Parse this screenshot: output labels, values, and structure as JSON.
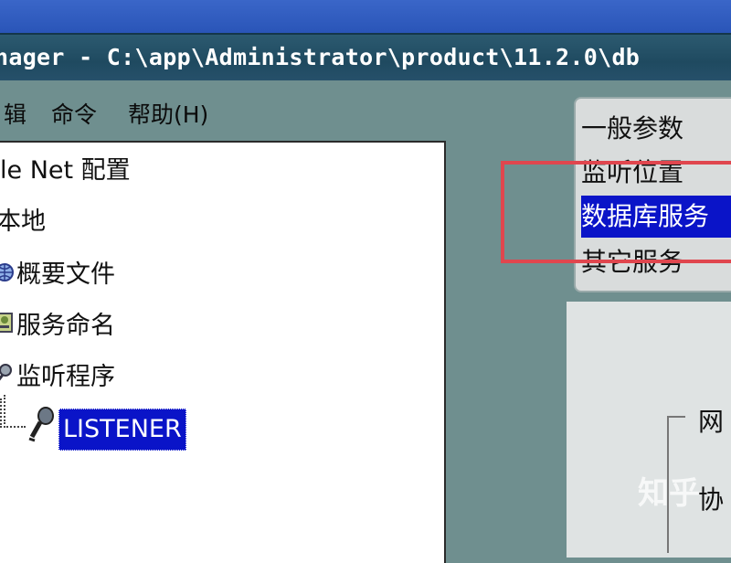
{
  "window": {
    "title": "nager - C:\\app\\Administrator\\product\\11.2.0\\db"
  },
  "menu": {
    "items": [
      {
        "label": "辑"
      },
      {
        "label": "命令"
      },
      {
        "label": "帮助(H)"
      }
    ]
  },
  "tree": {
    "root_label": "le Net 配置",
    "local_label": "本地",
    "profile_label": "概要文件",
    "service_naming_label": "服务命名",
    "listeners_label": "监听程序",
    "listener_label": "LISTENER"
  },
  "list_panel": {
    "items": [
      {
        "label": "一般参数",
        "selected": false
      },
      {
        "label": "监听位置",
        "selected": false
      },
      {
        "label": "数据库服务",
        "selected": true
      },
      {
        "label": "其它服务",
        "selected": false
      }
    ]
  },
  "right_panel": {
    "text1": "网",
    "text2": "协"
  },
  "watermark": "知乎",
  "colors": {
    "selection": "#0a14c8",
    "highlight_box": "#e0464e",
    "background": "#6f8f8f"
  }
}
